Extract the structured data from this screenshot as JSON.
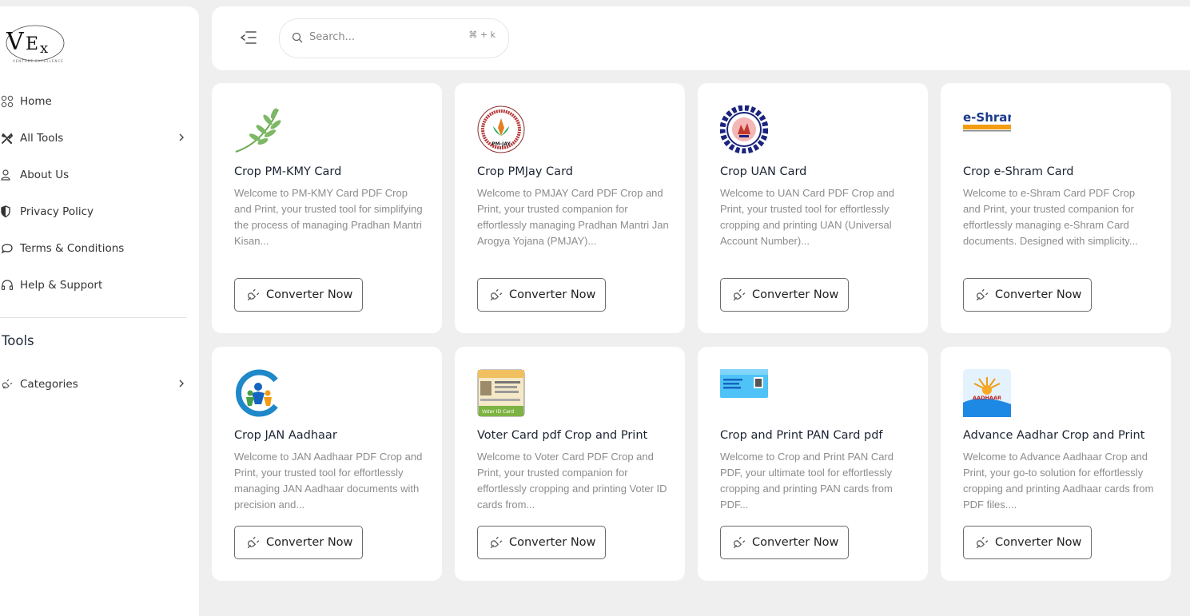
{
  "sidebar": {
    "logo_text": "VEx",
    "logo_tagline": "VENTURE EXCELLENCE",
    "nav": [
      {
        "label": "Home",
        "icon": "grid-icon"
      },
      {
        "label": "All Tools",
        "icon": "tools-icon"
      },
      {
        "label": "About Us",
        "icon": "user-icon"
      },
      {
        "label": "Privacy Policy",
        "icon": "shield-icon"
      },
      {
        "label": "Terms & Conditions",
        "icon": "chat-icon"
      },
      {
        "label": "Help & Support",
        "icon": "headset-icon"
      }
    ],
    "section_title": "Tools",
    "categories_label": "Categories"
  },
  "header": {
    "search_placeholder": "Search...",
    "search_shortcut": "⌘ + k"
  },
  "button_label": "Converter Now",
  "cards": [
    {
      "title": "Crop PM-KMY Card",
      "desc": "Welcome to PM-KMY Card PDF Crop and Print, your trusted tool for simplifying the process of managing Pradhan Mantri Kisan...",
      "icon": "wheat-leaf-icon"
    },
    {
      "title": "Crop PMJay Card",
      "desc": "Welcome to PMJAY Card PDF Crop and Print, your trusted companion for effortlessly managing Pradhan Mantri Jan Arogya Yojana (PMJAY)...",
      "icon": "pmjay-logo-icon",
      "logo_text": "PM-JAY"
    },
    {
      "title": "Crop UAN Card",
      "desc": "Welcome to UAN Card PDF Crop and Print, your trusted tool for effortlessly cropping and printing UAN (Universal Account Number)...",
      "icon": "epfo-logo-icon"
    },
    {
      "title": "Crop e-Shram Card",
      "desc": "Welcome to e-Shram Card PDF Crop and Print, your trusted companion for effortlessly managing e-Shram Card documents. Designed with simplicity...",
      "icon": "eshram-logo-icon",
      "logo_text": "e-Shram"
    },
    {
      "title": "Crop JAN Aadhaar",
      "desc": "Welcome to JAN Aadhaar PDF Crop and Print, your trusted tool for effortlessly managing JAN Aadhaar documents with precision and...",
      "icon": "jan-aadhaar-logo-icon"
    },
    {
      "title": "Voter Card pdf Crop and Print",
      "desc": "Welcome to Voter Card PDF Crop and Print, your trusted companion for effortlessly cropping and printing Voter ID cards from...",
      "icon": "voter-id-card-icon",
      "logo_text": "Voter ID Card"
    },
    {
      "title": "Crop and Print PAN Card pdf",
      "desc": "Welcome to Crop and Print PAN Card PDF, your ultimate tool for effortlessly cropping and printing PAN cards from PDF...",
      "icon": "pan-card-icon"
    },
    {
      "title": "Advance Aadhar Crop and Print",
      "desc": "Welcome to Advance Aadhaar Crop and Print, your go-to solution for effortlessly cropping and printing Aadhaar cards from PDF files....",
      "icon": "aadhaar-logo-icon",
      "logo_text": "AADHAAR"
    }
  ]
}
